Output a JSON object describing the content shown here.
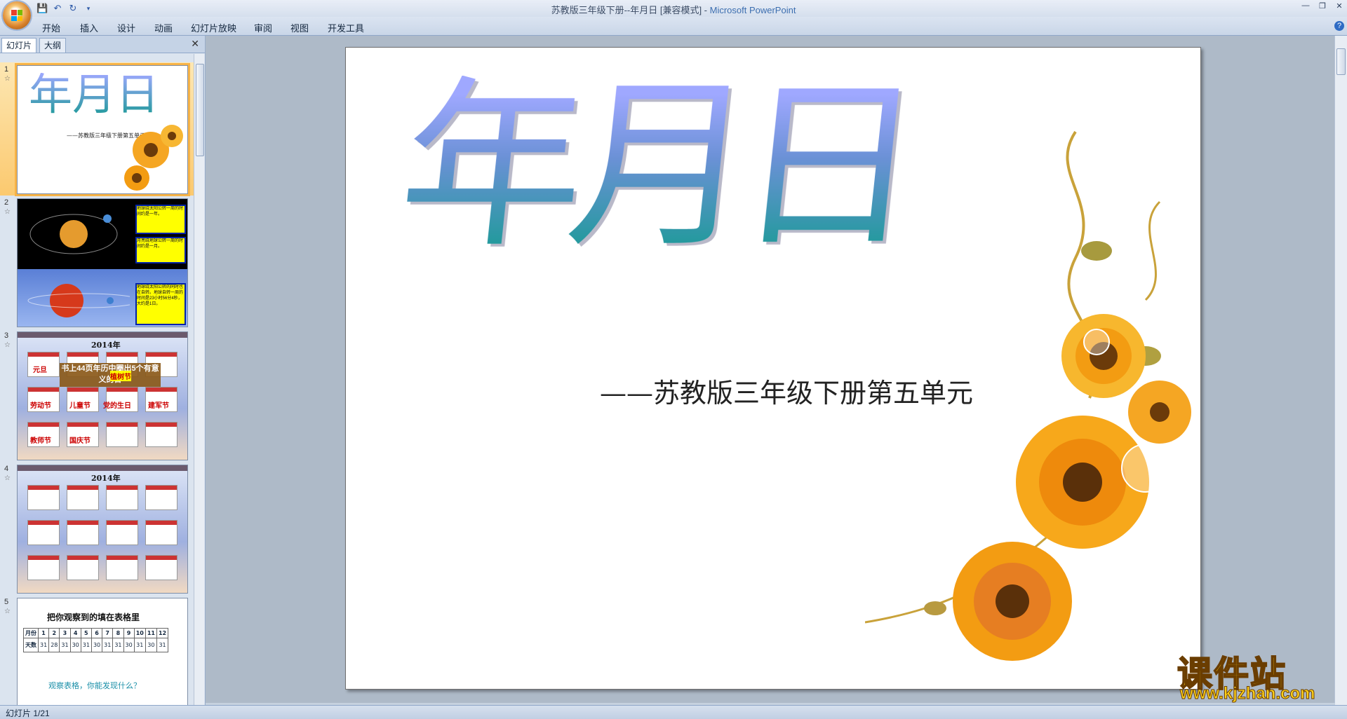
{
  "window": {
    "title": "苏教版三年级下册--年月日 [兼容模式] - ",
    "app_name": "Microsoft PowerPoint"
  },
  "ribbon": {
    "tabs": [
      "开始",
      "插入",
      "设计",
      "动画",
      "幻灯片放映",
      "审阅",
      "视图",
      "开发工具"
    ]
  },
  "panel": {
    "tab_slides": "幻灯片",
    "tab_outline": "大纲"
  },
  "thumbnails": [
    {
      "number": "1",
      "title": "年月日",
      "subtitle": "——苏教版三年级下册第五单元"
    },
    {
      "number": "2",
      "boxes": [
        "地球绕太阳公转一周的时间约是一年。",
        "月亮绕地球公转一周的时间约是一月。",
        "地球绕太阳公转的同时也在自转。地球自转一周的时间是23小时56分4秒，大约是1日。"
      ]
    },
    {
      "number": "3",
      "year": "2014年",
      "banner": "书上44页年历中圈出5个有意义的日",
      "labels": [
        "元旦",
        "植树节",
        "劳动节",
        "儿童节",
        "党的生日",
        "建军节",
        "教师节",
        "国庆节"
      ]
    },
    {
      "number": "4",
      "year": "2014年"
    },
    {
      "number": "5",
      "heading": "把你观察到的填在表格里",
      "row1_label": "月份",
      "row2_label": "天数",
      "months": [
        "1",
        "2",
        "3",
        "4",
        "5",
        "6",
        "7",
        "8",
        "9",
        "10",
        "11",
        "12"
      ],
      "days": [
        "31",
        "28",
        "31",
        "30",
        "31",
        "30",
        "31",
        "31",
        "30",
        "31",
        "30",
        "31"
      ],
      "footer": "观察表格，你能发现什么？"
    }
  ],
  "slide": {
    "title": "年月日",
    "subtitle": "——苏教版三年级下册第五单元"
  },
  "status": {
    "text": "幻灯片 1/21"
  },
  "watermark": {
    "cn": "课件站",
    "url": "www.kjzhan.com"
  }
}
